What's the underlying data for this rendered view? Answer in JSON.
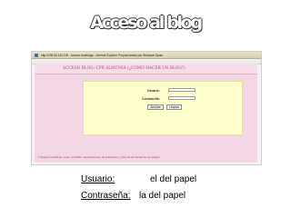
{
  "slide": {
    "title": "Acceso al blog"
  },
  "window": {
    "title": "http://195.55.130.130 - Acceso Avalblogs - Internet Explorer Proporcionado por Windows Spain"
  },
  "app": {
    "header": "ACCESO BLOG: CPR ALMUNIA (¿CÓMO HACER UN BLOG?)",
    "form": {
      "usuario_label": "Usuario:",
      "contrasena_label": "Contraseña:",
      "accept_label": "Aceptar",
      "clear_label": "Limpiar"
    },
    "footer": "© Equipo Avalblogs. autor: CATEDU. Departamento de Educación y Ciencia del Gobierno de Aragón"
  },
  "credentials": {
    "usuario_label": "Usuario:",
    "usuario_value": "el del papel",
    "contrasena_label": "Contraseña:",
    "contrasena_value": "la del papel"
  }
}
